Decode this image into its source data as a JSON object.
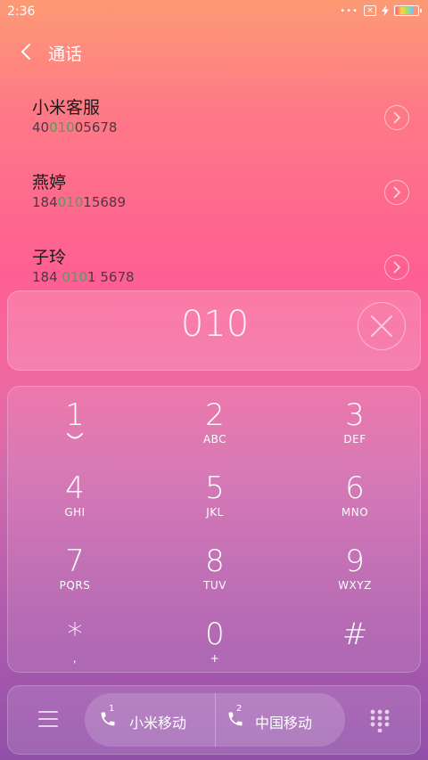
{
  "status": {
    "time": "2:36",
    "dots": "•••",
    "sim_mark": "×"
  },
  "header": {
    "title": "通话"
  },
  "contacts": [
    {
      "name": "小米客服",
      "number_pre": "40",
      "number_match": "010",
      "number_post": "05678"
    },
    {
      "name": "燕婷",
      "number_pre": "184",
      "number_match": "010",
      "number_post": "15689"
    },
    {
      "name": "子玲",
      "number_pre": "184 ",
      "number_match": "010",
      "number_post": "1 5678"
    }
  ],
  "dial_input": {
    "value": "010"
  },
  "keys": [
    {
      "digit": "1",
      "letters": ""
    },
    {
      "digit": "2",
      "letters": "ABC"
    },
    {
      "digit": "3",
      "letters": "DEF"
    },
    {
      "digit": "4",
      "letters": "GHI"
    },
    {
      "digit": "5",
      "letters": "JKL"
    },
    {
      "digit": "6",
      "letters": "MNO"
    },
    {
      "digit": "7",
      "letters": "PQRS"
    },
    {
      "digit": "8",
      "letters": "TUV"
    },
    {
      "digit": "9",
      "letters": "WXYZ"
    },
    {
      "digit": "*",
      "letters": ","
    },
    {
      "digit": "0",
      "letters": "+"
    },
    {
      "digit": "#",
      "letters": ""
    }
  ],
  "sim_buttons": [
    {
      "index": "1",
      "label": "小米移动"
    },
    {
      "index": "2",
      "label": "中国移动"
    }
  ],
  "colors": {
    "match_highlight": "#4f9f5e",
    "text_dark": "#1a1a1a"
  }
}
